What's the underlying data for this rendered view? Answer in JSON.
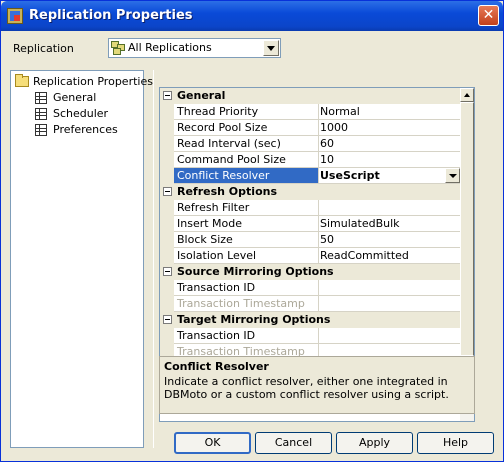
{
  "window": {
    "title": "Replication Properties",
    "close_glyph": "✕"
  },
  "replication": {
    "label": "Replication",
    "selected": "All Replications"
  },
  "tree": {
    "items": [
      {
        "label": "Replication Properties",
        "icon": "folder-icon"
      },
      {
        "label": "General",
        "icon": "grid-icon"
      },
      {
        "label": "Scheduler",
        "icon": "grid-icon"
      },
      {
        "label": "Preferences",
        "icon": "grid-icon"
      }
    ]
  },
  "properties": {
    "categories": [
      {
        "title": "General",
        "rows": [
          {
            "name": "Thread Priority",
            "value": "Normal"
          },
          {
            "name": "Record Pool Size",
            "value": "1000"
          },
          {
            "name": "Read Interval (sec)",
            "value": "60"
          },
          {
            "name": "Command Pool Size",
            "value": "10"
          },
          {
            "name": "Conflict Resolver",
            "value": "UseScript"
          }
        ]
      },
      {
        "title": "Refresh Options",
        "rows": [
          {
            "name": "Refresh Filter",
            "value": ""
          },
          {
            "name": "Insert Mode",
            "value": "SimulatedBulk"
          },
          {
            "name": "Block Size",
            "value": "50"
          },
          {
            "name": "Isolation Level",
            "value": "ReadCommitted"
          }
        ]
      },
      {
        "title": "Source Mirroring Options",
        "rows": [
          {
            "name": "Transaction ID",
            "value": ""
          },
          {
            "name": "Transaction Timestamp",
            "value": ""
          }
        ]
      },
      {
        "title": "Target Mirroring Options",
        "rows": [
          {
            "name": "Transaction ID",
            "value": ""
          },
          {
            "name": "Transaction Timestamp",
            "value": ""
          }
        ]
      }
    ]
  },
  "description": {
    "title": "Conflict Resolver",
    "text": "Indicate a conflict resolver, either one integrated in DBMoto or a custom conflict resolver using a script."
  },
  "buttons": {
    "ok": "OK",
    "cancel": "Cancel",
    "apply": "Apply",
    "help": "Help"
  },
  "colors": {
    "title_bar": "#0a4ad8",
    "selection": "#316ac5",
    "face": "#ece9d8"
  }
}
